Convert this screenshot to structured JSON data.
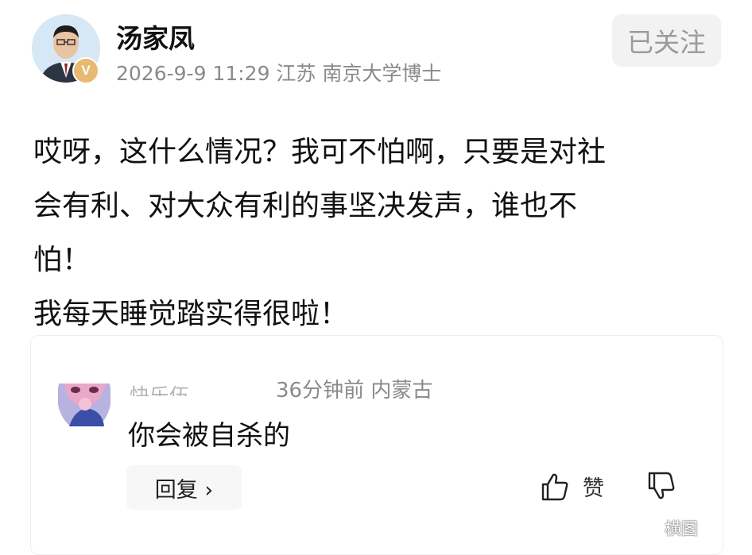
{
  "post": {
    "author": "汤家凤",
    "verified_badge": "V",
    "meta": "2026-9-9 11:29 江苏 南京大学博士",
    "follow_button": "已关注",
    "body_lines": [
      "哎呀，这什么情况？我可不怕啊，只要是对社",
      "会有利、对大众有利的事坚决发声，谁也不",
      "怕！",
      "我每天睡觉踏实得很啦！"
    ]
  },
  "comment": {
    "username": "快乐伍",
    "meta": "36分钟前  内蒙古",
    "text": "你会被自杀的",
    "reply_button": "回复 ›",
    "like_label": "赞",
    "like_icon": "thumbs-up-icon",
    "dislike_icon": "thumbs-down-icon"
  },
  "watermark": "横图",
  "colors": {
    "primary_text": "#111111",
    "secondary_text": "#8a8a8a",
    "follow_bg": "#f2f2f2",
    "verified_badge": "#e8b970"
  }
}
